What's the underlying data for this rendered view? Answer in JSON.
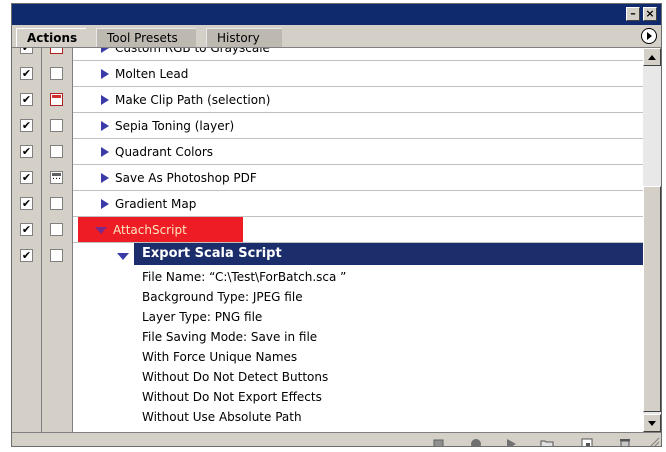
{
  "panel": {
    "tabs": [
      "Actions",
      "Tool Presets",
      "History"
    ],
    "active_tab": "Actions"
  },
  "actions": [
    {
      "label": "Custom RGB to Grayscale",
      "checked": true,
      "dialog": "red",
      "expanded": false
    },
    {
      "label": "Molten Lead",
      "checked": true,
      "dialog": "none",
      "expanded": false
    },
    {
      "label": "Make Clip Path (selection)",
      "checked": true,
      "dialog": "red",
      "expanded": false
    },
    {
      "label": "Sepia Toning (layer)",
      "checked": true,
      "dialog": "none",
      "expanded": false
    },
    {
      "label": "Quadrant Colors",
      "checked": true,
      "dialog": "none",
      "expanded": false
    },
    {
      "label": "Save As Photoshop PDF",
      "checked": true,
      "dialog": "gray",
      "expanded": false
    },
    {
      "label": "Gradient Map",
      "checked": true,
      "dialog": "none",
      "expanded": false
    },
    {
      "label": "AttachScript",
      "checked": true,
      "dialog": "none",
      "expanded": true,
      "highlight_color": "#ee1c24"
    }
  ],
  "command": {
    "label": "Export Scala Script",
    "checked": true,
    "params": [
      "File Name: “C:\\Test\\ForBatch.sca ”",
      "Background Type: JPEG file",
      "Layer Type: PNG file",
      "File Saving Mode: Save in file",
      "With Force Unique Names",
      "Without Do Not Detect Buttons",
      "Without Do Not Export Effects",
      "Without Use Absolute Path"
    ]
  },
  "toolbar": {
    "icons": [
      "stop-icon",
      "record-icon",
      "play-icon",
      "new-set-icon",
      "new-action-icon",
      "trash-icon"
    ]
  },
  "colors": {
    "title_bar": "#0f2a6d",
    "selected_command": "#1b2d6b",
    "attach_highlight": "#ee1c24",
    "triangle": "#3a3aa8"
  }
}
